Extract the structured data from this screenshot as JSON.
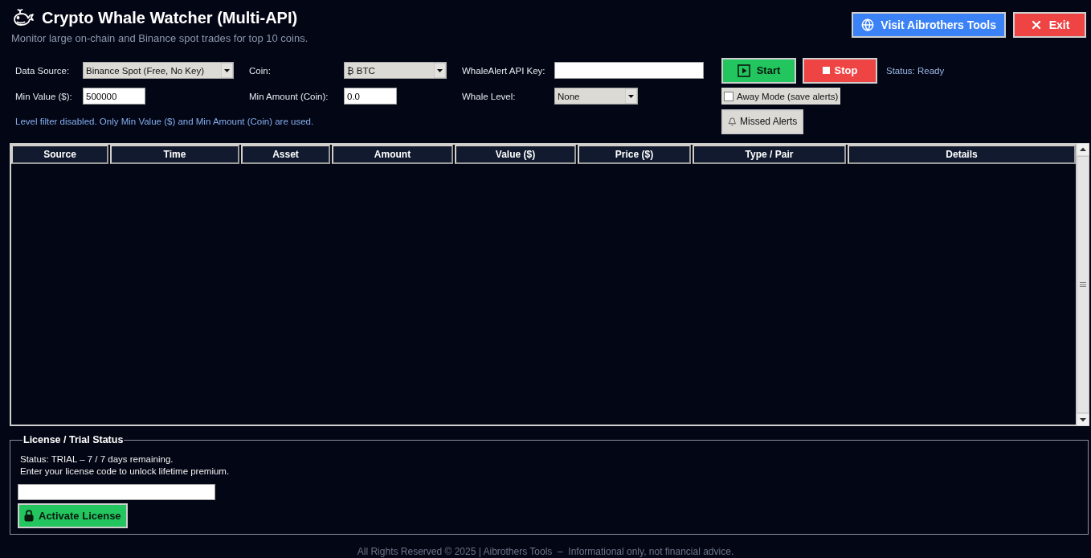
{
  "window": {
    "title": "Crypto Whale Watcher (Multi-API)",
    "subtitle": "Monitor large on-chain and Binance spot trades for top 10 coins."
  },
  "header_buttons": [
    {
      "label": "Visit Aibrothers Tools",
      "kind": "link"
    },
    {
      "label": "Exit",
      "kind": "exit"
    }
  ],
  "settings": {
    "rows": [
      [
        {
          "label": "Data Source:",
          "kind": "select",
          "value": "Binance Spot (Free, No Key)"
        },
        {
          "label": "Coin:",
          "kind": "select",
          "value": "₿ BTC"
        },
        {
          "label": "WhaleAlert API Key:",
          "kind": "input"
        }
      ],
      [
        {
          "label": "Min Value ($):",
          "kind": "input",
          "value": "500000"
        },
        {
          "label": "Min Amount (Coin):",
          "kind": "input",
          "value": "0.0"
        },
        {
          "label": "Whale Level:",
          "kind": "select",
          "value": "None"
        }
      ]
    ],
    "note": "Level filter disabled. Only Min Value ($) and Min Amount (Coin) are used."
  },
  "actions": {
    "buttons": [
      {
        "label": "Start",
        "kind": "start"
      },
      {
        "label": "Stop",
        "kind": "stop"
      }
    ],
    "status": "Status: Ready",
    "away_mode": {
      "label": "Away Mode (save alerts)",
      "checked": false
    },
    "missed_alerts": {
      "label": "Missed Alerts",
      "kind": "alerts"
    }
  },
  "table": {
    "columns": [
      "Source",
      "Time",
      "Asset",
      "Amount",
      "Value ($)",
      "Price ($)",
      "Type / Pair",
      "Details"
    ]
  },
  "license": {
    "title": "License / Trial Status",
    "status": "Status: TRIAL – 7 / 7 days remaining.",
    "hint": "Enter your license code to unlock lifetime premium.",
    "button": {
      "label": "Activate License",
      "kind": "activate"
    }
  },
  "status_bar": {
    "text": "All Rights Reserved © 2025 | Aibrothers Tools  –  Informational only, not financial advice."
  }
}
